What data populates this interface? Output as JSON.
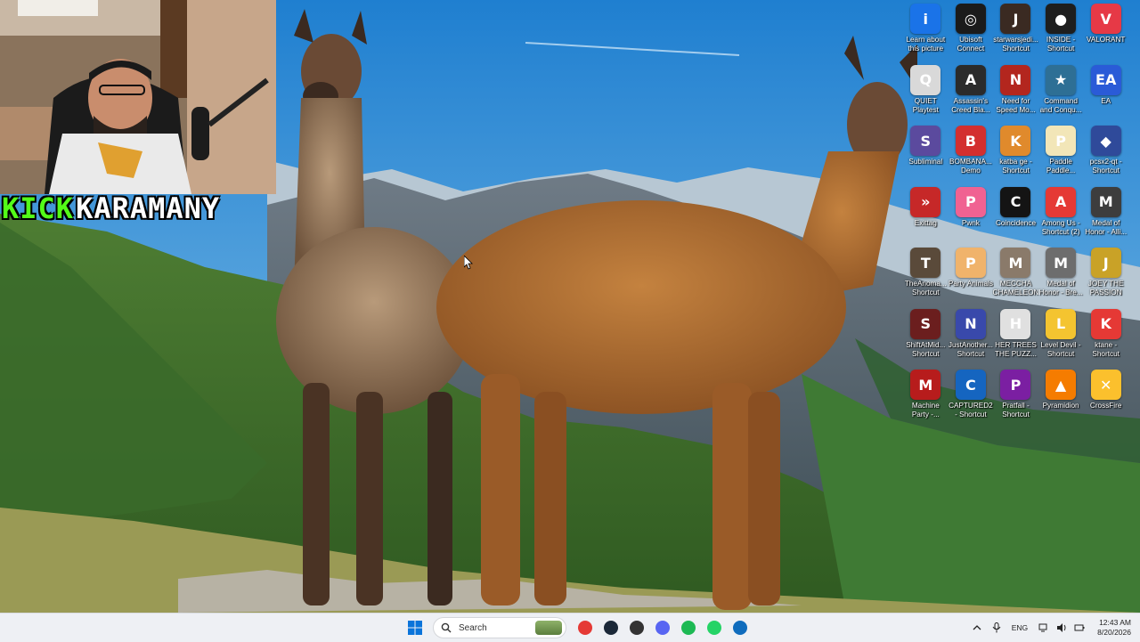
{
  "overlay": {
    "platform": "KICK",
    "streamer": "KARAMANY"
  },
  "desktop": {
    "icons": [
      {
        "label": "Learn about this picture",
        "glyph": "i",
        "color": "#1a73e8",
        "icon": "info-icon"
      },
      {
        "label": "Ubisoft Connect",
        "glyph": "◎",
        "color": "#1b1b1b",
        "icon": "ubisoft-icon"
      },
      {
        "label": "starwarsjedi... Shortcut",
        "glyph": "J",
        "color": "#3a2a22",
        "icon": "jedi-icon"
      },
      {
        "label": "INSIDE - Shortcut",
        "glyph": "●",
        "color": "#1e1e1e",
        "icon": "inside-icon"
      },
      {
        "label": "VALORANT",
        "glyph": "V",
        "color": "#e63946",
        "icon": "valorant-icon"
      },
      {
        "label": "QUIET Playtest",
        "glyph": "Q",
        "color": "#d9d9d9",
        "icon": "quiet-icon"
      },
      {
        "label": "Assassin's Creed Bla...",
        "glyph": "A",
        "color": "#2b2b2b",
        "icon": "assassins-creed-icon"
      },
      {
        "label": "Need for Speed Mo...",
        "glyph": "N",
        "color": "#b3261e",
        "icon": "nfs-icon"
      },
      {
        "label": "Command and Conqu...",
        "glyph": "★",
        "color": "#2e6f95",
        "icon": "command-conquer-icon"
      },
      {
        "label": "EA",
        "glyph": "EA",
        "color": "#2a5bd7",
        "icon": "ea-icon"
      },
      {
        "label": "Subliminal",
        "glyph": "S",
        "color": "#5b4a9e",
        "icon": "subliminal-icon"
      },
      {
        "label": "BOMBANA... Demo",
        "glyph": "B",
        "color": "#d32f2f",
        "icon": "bombana-icon"
      },
      {
        "label": "katba ge - Shortcut",
        "glyph": "K",
        "color": "#e08a2c",
        "icon": "katba-icon"
      },
      {
        "label": "Paddle Paddle...",
        "glyph": "P",
        "color": "#f2e6b8",
        "icon": "paddle-icon"
      },
      {
        "label": "pcsx2-qt - Shortcut",
        "glyph": "◆",
        "color": "#2f4a9a",
        "icon": "pcsx2-icon"
      },
      {
        "label": "Exittag",
        "glyph": "»",
        "color": "#c62828",
        "icon": "exittag-icon"
      },
      {
        "label": "Pwnk",
        "glyph": "P",
        "color": "#f06292",
        "icon": "pwnk-icon"
      },
      {
        "label": "Coincidence",
        "glyph": "C",
        "color": "#141414",
        "icon": "coincidence-icon"
      },
      {
        "label": "Among Us - Shortcut (2)",
        "glyph": "A",
        "color": "#e53935",
        "icon": "among-us-icon"
      },
      {
        "label": "Medal of Honor - Alli...",
        "glyph": "M",
        "color": "#3d3d3d",
        "icon": "medal-of-honor-icon"
      },
      {
        "label": "TheAnoma... Shortcut",
        "glyph": "T",
        "color": "#5a4a3a",
        "icon": "anomaly-icon"
      },
      {
        "label": "Party Animals",
        "glyph": "P",
        "color": "#f0b36b",
        "icon": "party-animals-icon"
      },
      {
        "label": "MECCHA CHAMELEON",
        "glyph": "M",
        "color": "#8a7a6a",
        "icon": "meccha-icon"
      },
      {
        "label": "Medal of Honor - Bre...",
        "glyph": "M",
        "color": "#6d6d6d",
        "icon": "medal-of-honor-breakthrough-icon"
      },
      {
        "label": "JOEY THE PASSION",
        "glyph": "J",
        "color": "#c9a227",
        "icon": "joey-icon"
      },
      {
        "label": "ShiftAtMid... Shortcut",
        "glyph": "S",
        "color": "#6b1e1e",
        "icon": "shift-at-midnight-icon"
      },
      {
        "label": "JustAnother... Shortcut",
        "glyph": "N",
        "color": "#3949ab",
        "icon": "just-another-icon"
      },
      {
        "label": "HER TREES THE PUZZ...",
        "glyph": "H",
        "color": "#e0e0e0",
        "icon": "her-trees-icon"
      },
      {
        "label": "Level Devil - Shortcut",
        "glyph": "L",
        "color": "#f4c430",
        "icon": "level-devil-icon"
      },
      {
        "label": "ktane - Shortcut",
        "glyph": "K",
        "color": "#e53935",
        "icon": "ktane-icon"
      },
      {
        "label": "Machine Party -...",
        "glyph": "M",
        "color": "#b71c1c",
        "icon": "machine-party-icon"
      },
      {
        "label": "CAPTURED2 - Shortcut",
        "glyph": "C",
        "color": "#1565c0",
        "icon": "captured2-icon"
      },
      {
        "label": "Pratfall - Shortcut",
        "glyph": "P",
        "color": "#7b1fa2",
        "icon": "pratfall-icon"
      },
      {
        "label": "Pyramidion",
        "glyph": "▲",
        "color": "#f57c00",
        "icon": "pyramidion-icon"
      },
      {
        "label": "CrossFire",
        "glyph": "✕",
        "color": "#fbc02d",
        "icon": "crossfire-icon"
      }
    ]
  },
  "taskbar": {
    "search_placeholder": "Search",
    "apps": [
      {
        "name": "chrome-icon",
        "color": "#e53935"
      },
      {
        "name": "steam-icon",
        "color": "#1b2838"
      },
      {
        "name": "obs-icon",
        "color": "#333333"
      },
      {
        "name": "discord-icon",
        "color": "#5865f2"
      },
      {
        "name": "spotify-icon",
        "color": "#1db954"
      },
      {
        "name": "whatsapp-icon",
        "color": "#25d366"
      },
      {
        "name": "outlook-icon",
        "color": "#0f6cbd"
      }
    ],
    "tray": {
      "language": "ENG",
      "time": "12:43 AM",
      "date": "8/20/2026"
    }
  }
}
